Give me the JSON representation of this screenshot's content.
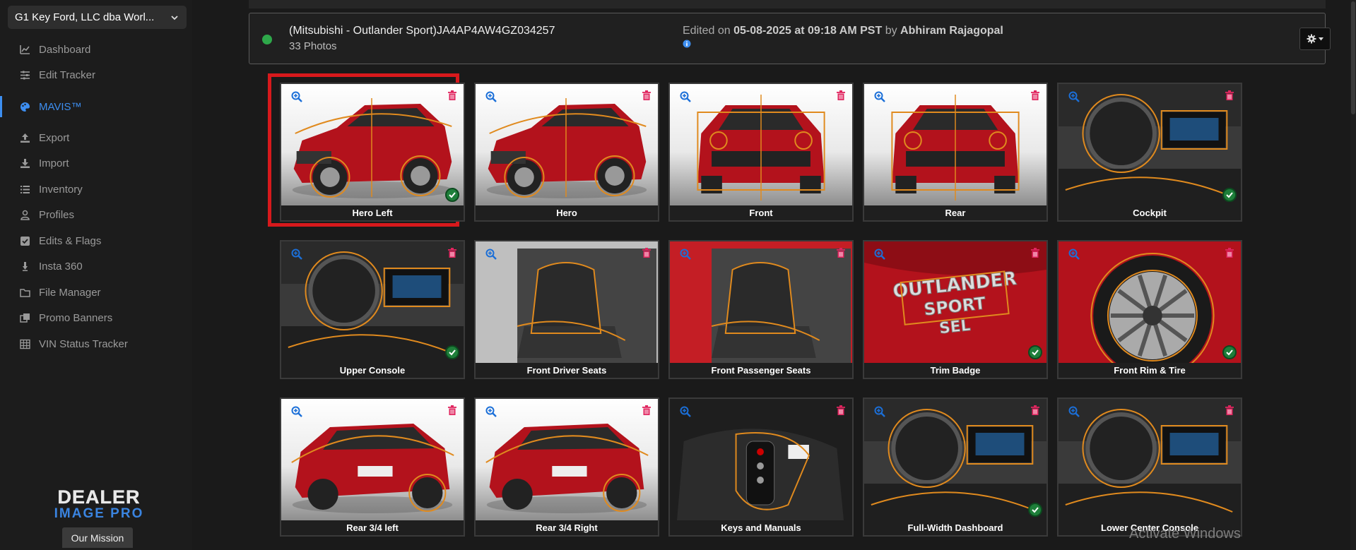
{
  "sidebar": {
    "dealer": "G1 Key Ford, LLC dba Worl...",
    "items": [
      {
        "label": "Dashboard",
        "icon": "chart-line-icon"
      },
      {
        "label": "Edit Tracker",
        "icon": "sliders-icon"
      },
      {
        "label": "MAVIS™",
        "icon": "palette-icon",
        "active": true
      },
      {
        "label": "Export",
        "icon": "upload-icon"
      },
      {
        "label": "Import",
        "icon": "download-icon"
      },
      {
        "label": "Inventory",
        "icon": "list-icon"
      },
      {
        "label": "Profiles",
        "icon": "user-icon"
      },
      {
        "label": "Edits & Flags",
        "icon": "check-square-icon"
      },
      {
        "label": "Insta 360",
        "icon": "camera-icon"
      },
      {
        "label": "File Manager",
        "icon": "folder-icon"
      },
      {
        "label": "Promo Banners",
        "icon": "clone-icon"
      },
      {
        "label": "VIN Status Tracker",
        "icon": "table-icon"
      }
    ],
    "logo_line1": "DEALER",
    "logo_line2": "IMAGE PRO",
    "mission_label": "Our Mission"
  },
  "header": {
    "vin_title": "(Mitsubishi - Outlander Sport)JA4AP4AW4GZ034257",
    "photo_count": "33 Photos",
    "edited_prefix": "Edited on ",
    "edited_date": "05-08-2025 at 09:18 AM PST",
    "edited_by_word": " by ",
    "edited_user": "Abhiram Rajagopal"
  },
  "photos": [
    {
      "label": "Hero Left",
      "checked": true,
      "selected": true,
      "theme": "car-side"
    },
    {
      "label": "Hero",
      "checked": false,
      "theme": "car-side2"
    },
    {
      "label": "Front",
      "checked": false,
      "theme": "car-front"
    },
    {
      "label": "Rear",
      "checked": false,
      "theme": "car-rear"
    },
    {
      "label": "Cockpit",
      "checked": true,
      "theme": "interior"
    },
    {
      "label": "Upper Console",
      "checked": true,
      "theme": "interior"
    },
    {
      "label": "Front Driver Seats",
      "checked": false,
      "theme": "seats"
    },
    {
      "label": "Front Passenger Seats",
      "checked": false,
      "theme": "seats-red"
    },
    {
      "label": "Trim Badge",
      "checked": true,
      "theme": "badge"
    },
    {
      "label": "Front Rim & Tire",
      "checked": true,
      "theme": "wheel"
    },
    {
      "label": "Rear 3/4 left",
      "checked": false,
      "theme": "car-rear34"
    },
    {
      "label": "Rear 3/4 Right",
      "checked": false,
      "theme": "car-rear34"
    },
    {
      "label": "Keys and Manuals",
      "checked": false,
      "theme": "keys"
    },
    {
      "label": "Full-Width Dashboard",
      "checked": true,
      "theme": "interior"
    },
    {
      "label": "Lower Center Console",
      "checked": false,
      "theme": "interior"
    }
  ],
  "watermark": "Activate Windows",
  "colors": {
    "accent": "#3d8ef0",
    "selection": "#d7191c",
    "status_ok": "#2ea84a",
    "car_red": "#b3121c",
    "overlay": "#e08a1e"
  }
}
